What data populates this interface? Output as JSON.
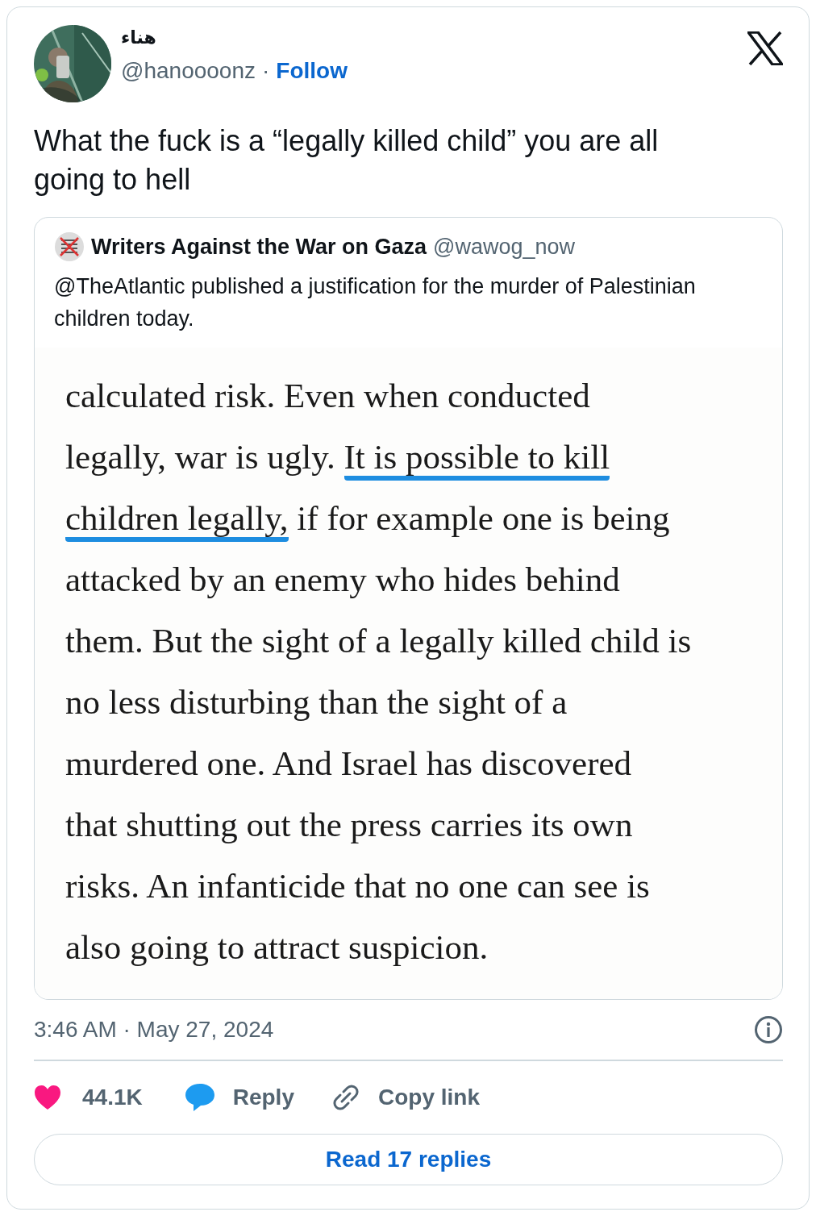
{
  "author": {
    "name": "هناء",
    "handle": "@hanoooonz",
    "separator": "·",
    "follow": "Follow"
  },
  "text": "What the fuck is a “legally killed child” you are all going to hell",
  "quote": {
    "name": "Writers Against the War on Gaza",
    "handle": "@wawog_now",
    "text": "@TheAtlantic published a justification for the murder of Palestinian children today.",
    "document_lines": [
      [
        {
          "text": "calculated risk. Even when conducted",
          "underlined": false
        }
      ],
      [
        {
          "text": "legally, war is ugly. ",
          "underlined": false
        },
        {
          "text": "It is possible to kill",
          "underlined": true
        }
      ],
      [
        {
          "text": "children legally,",
          "underlined": true
        },
        {
          "text": " if for example one is being",
          "underlined": false
        }
      ],
      [
        {
          "text": "attacked by an enemy who hides behind",
          "underlined": false
        }
      ],
      [
        {
          "text": "them. But the sight of a legally killed child is",
          "underlined": false
        }
      ],
      [
        {
          "text": "no less disturbing than the sight of a",
          "underlined": false
        }
      ],
      [
        {
          "text": "murdered one. And Israel has discovered",
          "underlined": false
        }
      ],
      [
        {
          "text": "that shutting out the press carries its own",
          "underlined": false
        }
      ],
      [
        {
          "text": "risks. An infanticide that no one can see is",
          "underlined": false
        }
      ],
      [
        {
          "text": "also going to attract suspicion.",
          "underlined": false
        }
      ]
    ]
  },
  "timestamp": "3:46 AM · May 27, 2024",
  "actions": [
    {
      "kind": "like",
      "label": "44.1K"
    },
    {
      "kind": "reply",
      "label": "Reply"
    },
    {
      "kind": "copy",
      "label": "Copy link"
    }
  ],
  "read_replies": "Read 17 replies"
}
